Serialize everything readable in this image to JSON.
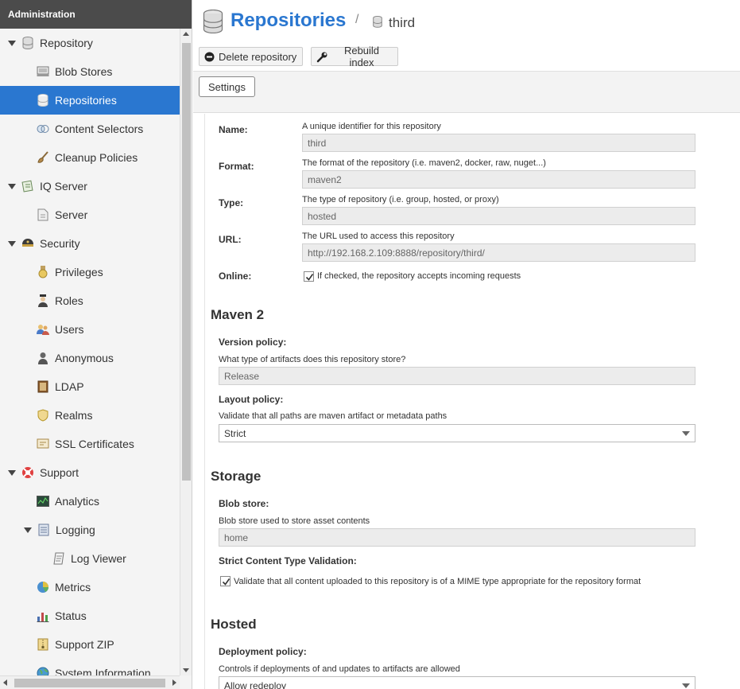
{
  "sidebar": {
    "title": "Administration",
    "items": [
      {
        "label": "Repository",
        "icon": "database-icon",
        "level": 0,
        "expanded": true
      },
      {
        "label": "Blob Stores",
        "icon": "server-icon",
        "level": 1
      },
      {
        "label": "Repositories",
        "icon": "database-icon",
        "level": 1,
        "selected": true
      },
      {
        "label": "Content Selectors",
        "icon": "selector-icon",
        "level": 1
      },
      {
        "label": "Cleanup Policies",
        "icon": "brush-icon",
        "level": 1
      },
      {
        "label": "IQ Server",
        "icon": "iq-server-icon",
        "level": 0,
        "expanded": true
      },
      {
        "label": "Server",
        "icon": "document-icon",
        "level": 1
      },
      {
        "label": "Security",
        "icon": "security-icon",
        "level": 0,
        "expanded": true
      },
      {
        "label": "Privileges",
        "icon": "medal-icon",
        "level": 1
      },
      {
        "label": "Roles",
        "icon": "role-icon",
        "level": 1
      },
      {
        "label": "Users",
        "icon": "users-icon",
        "level": 1
      },
      {
        "label": "Anonymous",
        "icon": "anonymous-icon",
        "level": 1
      },
      {
        "label": "LDAP",
        "icon": "book-icon",
        "level": 1
      },
      {
        "label": "Realms",
        "icon": "shield-icon",
        "level": 1
      },
      {
        "label": "SSL Certificates",
        "icon": "certificate-icon",
        "level": 1
      },
      {
        "label": "Support",
        "icon": "lifebuoy-icon",
        "level": 0,
        "expanded": true
      },
      {
        "label": "Analytics",
        "icon": "analytics-icon",
        "level": 1
      },
      {
        "label": "Logging",
        "icon": "logging-icon",
        "level": 1,
        "expanded": true
      },
      {
        "label": "Log Viewer",
        "icon": "log-viewer-icon",
        "level": 2
      },
      {
        "label": "Metrics",
        "icon": "pie-chart-icon",
        "level": 1
      },
      {
        "label": "Status",
        "icon": "bar-chart-icon",
        "level": 1
      },
      {
        "label": "Support ZIP",
        "icon": "zip-icon",
        "level": 1
      },
      {
        "label": "System Information",
        "icon": "globe-icon",
        "level": 1
      }
    ]
  },
  "header": {
    "title": "Repositories",
    "separator": "/",
    "current": "third"
  },
  "toolbar": {
    "delete_label": "Delete repository",
    "rebuild_label": "Rebuild index"
  },
  "tabs": {
    "settings_label": "Settings"
  },
  "form": {
    "name": {
      "label": "Name:",
      "help": "A unique identifier for this repository",
      "value": "third"
    },
    "format": {
      "label": "Format:",
      "help": "The format of the repository (i.e. maven2, docker, raw, nuget...)",
      "value": "maven2"
    },
    "type": {
      "label": "Type:",
      "help": "The type of repository (i.e. group, hosted, or proxy)",
      "value": "hosted"
    },
    "url": {
      "label": "URL:",
      "help": "The URL used to access this repository",
      "value": "http://192.168.2.109:8888/repository/third/"
    },
    "online": {
      "label": "Online:",
      "checked": true,
      "help": "If checked, the repository accepts incoming requests"
    },
    "maven": {
      "heading": "Maven 2",
      "version_policy": {
        "label": "Version policy:",
        "help": "What type of artifacts does this repository store?",
        "value": "Release"
      },
      "layout_policy": {
        "label": "Layout policy:",
        "help": "Validate that all paths are maven artifact or metadata paths",
        "value": "Strict"
      }
    },
    "storage": {
      "heading": "Storage",
      "blob_store": {
        "label": "Blob store:",
        "help": "Blob store used to store asset contents",
        "value": "home"
      },
      "strict_content": {
        "label": "Strict Content Type Validation:",
        "checked": true,
        "help": "Validate that all content uploaded to this repository is of a MIME type appropriate for the repository format"
      }
    },
    "hosted": {
      "heading": "Hosted",
      "deployment_policy": {
        "label": "Deployment policy:",
        "help": "Controls if deployments of and updates to artifacts are allowed",
        "value": "Allow redeploy"
      }
    }
  }
}
